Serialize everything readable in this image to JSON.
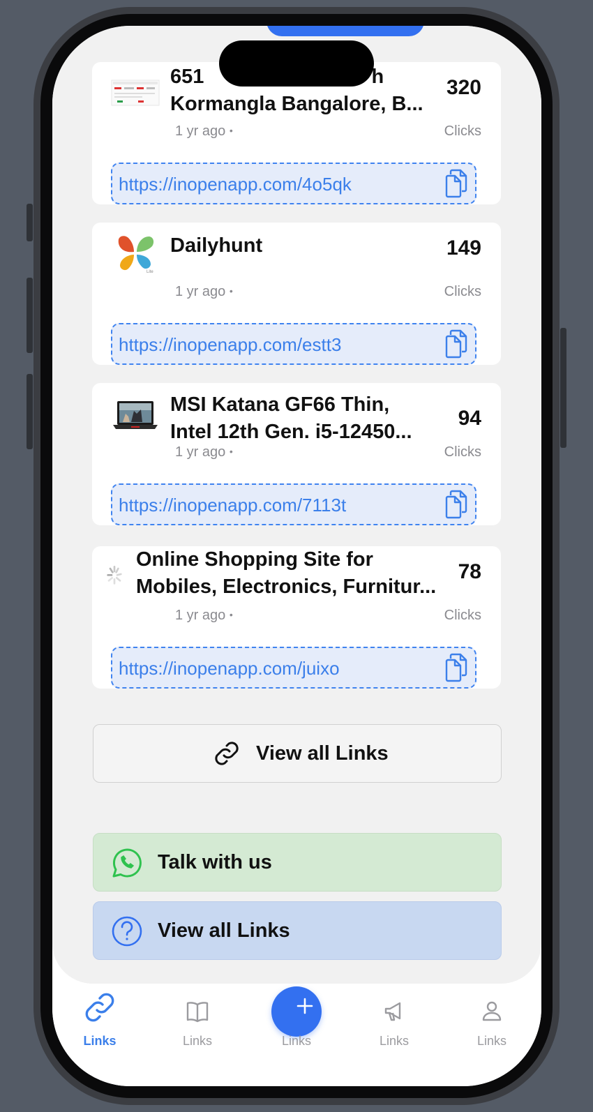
{
  "links": [
    {
      "title": "651         h\nKormangla Bangalore, B...",
      "clicks": "320",
      "time": "1 yr ago",
      "clicks_label": "Clicks",
      "url": "https://inopenapp.com/4o5qk",
      "thumb": "screenshot-thumbnail"
    },
    {
      "title": "Dailyhunt",
      "clicks": "149",
      "time": "1 yr ago",
      "clicks_label": "Clicks",
      "url": "https://inopenapp.com/estt3",
      "thumb": "dailyhunt-logo"
    },
    {
      "title": "MSI Katana GF66 Thin,\nIntel 12th Gen. i5-12450...",
      "clicks": "94",
      "time": "1 yr ago",
      "clicks_label": "Clicks",
      "url": "https://inopenapp.com/7113t",
      "thumb": "laptop-thumbnail"
    },
    {
      "title": "Online Shopping Site for\nMobiles, Electronics, Furnitur...",
      "clicks": "78",
      "time": "1 yr ago",
      "clicks_label": "Clicks",
      "url": "https://inopenapp.com/juixo",
      "thumb": "loading-spinner"
    }
  ],
  "actions": {
    "view_all_links": "View all Links",
    "talk_with_us": "Talk with us",
    "help_view_all_links": "View all Links"
  },
  "tabs": [
    {
      "label": "Links",
      "icon": "link-icon",
      "active": true
    },
    {
      "label": "Links",
      "icon": "book-icon",
      "active": false
    },
    {
      "label": "Links",
      "icon": "plus-icon",
      "active": false
    },
    {
      "label": "Links",
      "icon": "megaphone-icon",
      "active": false
    },
    {
      "label": "Links",
      "icon": "user-icon",
      "active": false
    }
  ],
  "colors": {
    "accent": "#3370f0",
    "url_text": "#3b7fea",
    "whatsapp": "#2fc24e",
    "talk_bg": "#d4ead3",
    "help_bg": "#c8d8f1"
  }
}
